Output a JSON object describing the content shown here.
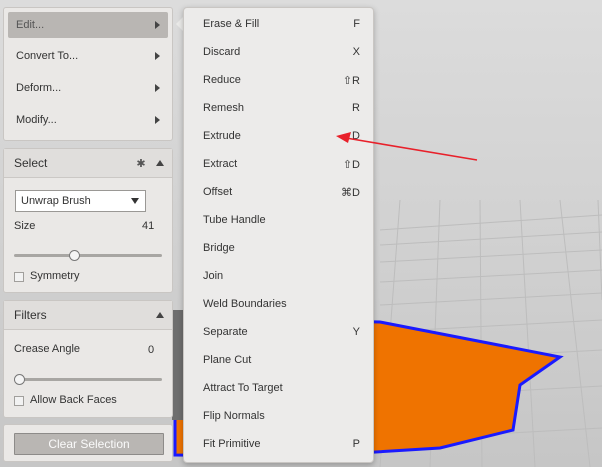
{
  "tools_menu": {
    "items": [
      {
        "label": "Edit..."
      },
      {
        "label": "Convert To..."
      },
      {
        "label": "Deform..."
      },
      {
        "label": "Modify..."
      }
    ]
  },
  "select_panel": {
    "title": "Select",
    "brush_value": "Unwrap Brush",
    "size_label": "Size",
    "size_value": "41",
    "size_fraction": 0.41,
    "symmetry_label": "Symmetry",
    "symmetry_checked": false
  },
  "filters_panel": {
    "title": "Filters",
    "crease_label": "Crease Angle",
    "crease_value": "0",
    "crease_fraction": 0,
    "back_faces_label": "Allow Back Faces",
    "back_faces_checked": false
  },
  "clear_selection_label": "Clear Selection",
  "edit_submenu": {
    "items": [
      {
        "label": "Erase & Fill",
        "shortcut": "F"
      },
      {
        "label": "Discard",
        "shortcut": "X"
      },
      {
        "label": "Reduce",
        "shortcut": "⇧R"
      },
      {
        "label": "Remesh",
        "shortcut": "R"
      },
      {
        "label": "Extrude",
        "shortcut": "D"
      },
      {
        "label": "Extract",
        "shortcut": "⇧D"
      },
      {
        "label": "Offset",
        "shortcut": "⌘D"
      },
      {
        "label": "Tube Handle",
        "shortcut": ""
      },
      {
        "label": "Bridge",
        "shortcut": ""
      },
      {
        "label": "Join",
        "shortcut": ""
      },
      {
        "label": "Weld Boundaries",
        "shortcut": ""
      },
      {
        "label": "Separate",
        "shortcut": "Y"
      },
      {
        "label": "Plane Cut",
        "shortcut": ""
      },
      {
        "label": "Attract To Target",
        "shortcut": ""
      },
      {
        "label": "Flip Normals",
        "shortcut": ""
      },
      {
        "label": "Fit Primitive",
        "shortcut": "P"
      }
    ]
  },
  "colors": {
    "mesh_fill": "#ef7300",
    "mesh_boundary": "#1a1aff",
    "annotation_arrow": "#e8202a"
  }
}
